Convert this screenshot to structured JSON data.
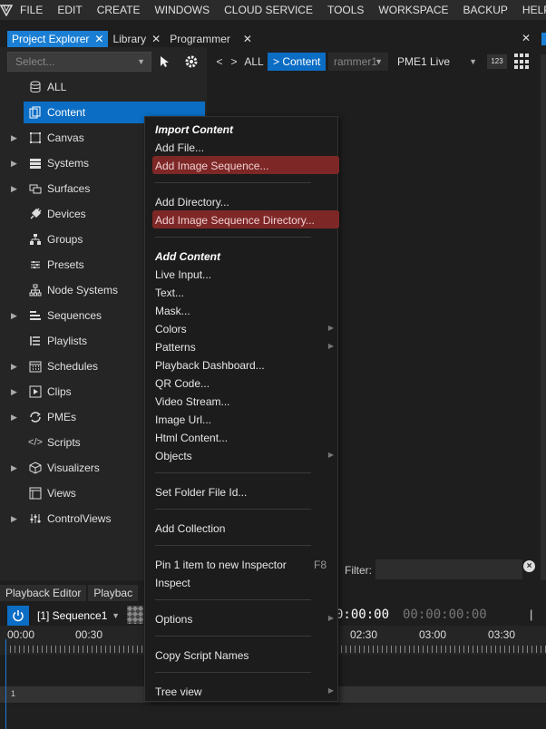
{
  "menubar": {
    "items": [
      "FILE",
      "EDIT",
      "CREATE",
      "WINDOWS",
      "CLOUD SERVICE",
      "TOOLS",
      "WORKSPACE",
      "BACKUP",
      "HELP"
    ]
  },
  "panel_tabs": [
    {
      "label": "Project Explorer",
      "active": true
    },
    {
      "label": "Library",
      "active": false
    },
    {
      "label": "Programmer",
      "active": false
    }
  ],
  "explorer": {
    "select_placeholder": "Select...",
    "tree": [
      {
        "label": "ALL",
        "icon": "database-icon",
        "expandable": false
      },
      {
        "label": "Content",
        "icon": "content-copy-icon",
        "expandable": false,
        "selected": true
      },
      {
        "label": "Canvas",
        "icon": "canvas-icon",
        "expandable": true
      },
      {
        "label": "Systems",
        "icon": "server-icon",
        "expandable": true
      },
      {
        "label": "Surfaces",
        "icon": "surfaces-icon",
        "expandable": true
      },
      {
        "label": "Devices",
        "icon": "plug-icon",
        "expandable": false
      },
      {
        "label": "Groups",
        "icon": "groups-icon",
        "expandable": false
      },
      {
        "label": "Presets",
        "icon": "sliders-icon",
        "expandable": false
      },
      {
        "label": "Node Systems",
        "icon": "node-tree-icon",
        "expandable": false
      },
      {
        "label": "Sequences",
        "icon": "sequences-icon",
        "expandable": true
      },
      {
        "label": "Playlists",
        "icon": "playlist-icon",
        "expandable": false
      },
      {
        "label": "Schedules",
        "icon": "calendar-icon",
        "expandable": true
      },
      {
        "label": "Clips",
        "icon": "clips-icon",
        "expandable": true
      },
      {
        "label": "PMEs",
        "icon": "sync-icon",
        "expandable": true
      },
      {
        "label": "Scripts",
        "icon": "code-icon",
        "expandable": false
      },
      {
        "label": "Visualizers",
        "icon": "cube-icon",
        "expandable": true
      },
      {
        "label": "Views",
        "icon": "views-icon",
        "expandable": false
      },
      {
        "label": "ControlViews",
        "icon": "control-views-icon",
        "expandable": true
      }
    ]
  },
  "content_toolbar": {
    "back": "<",
    "forward": ">",
    "all": "ALL",
    "crumb": "> Content",
    "programmer_select": "rammer1",
    "pme_select": "PME1 Live",
    "badge": "123"
  },
  "filter": {
    "label": "Filter:",
    "value": ""
  },
  "playback": {
    "tabs": [
      "Playback Editor",
      "Playbac"
    ],
    "sequence": "[1] Sequence1",
    "timecode_current": "0:00:00",
    "timecode_total": "00:00:00:00",
    "ruler_labels": [
      "00:00",
      "00:30",
      "02:30",
      "03:00",
      "03:30"
    ],
    "track_number": "1"
  },
  "context_menu": {
    "items": [
      {
        "type": "header",
        "label": "Import Content"
      },
      {
        "type": "item",
        "label": "Add File..."
      },
      {
        "type": "item",
        "label": "Add Image Sequence...",
        "highlight": true
      },
      {
        "type": "separator"
      },
      {
        "type": "item",
        "label": "Add Directory..."
      },
      {
        "type": "item",
        "label": "Add Image Sequence Directory...",
        "highlight": true
      },
      {
        "type": "separator"
      },
      {
        "type": "header",
        "label": "Add Content"
      },
      {
        "type": "item",
        "label": "Live Input..."
      },
      {
        "type": "item",
        "label": "Text..."
      },
      {
        "type": "item",
        "label": "Mask..."
      },
      {
        "type": "item",
        "label": "Colors",
        "submenu": true
      },
      {
        "type": "item",
        "label": "Patterns",
        "submenu": true
      },
      {
        "type": "item",
        "label": "Playback Dashboard..."
      },
      {
        "type": "item",
        "label": "QR Code..."
      },
      {
        "type": "item",
        "label": "Video Stream..."
      },
      {
        "type": "item",
        "label": "Image Url..."
      },
      {
        "type": "item",
        "label": "Html Content..."
      },
      {
        "type": "item",
        "label": "Objects",
        "submenu": true
      },
      {
        "type": "separator"
      },
      {
        "type": "item",
        "label": "Set Folder File Id..."
      },
      {
        "type": "separator"
      },
      {
        "type": "item",
        "label": "Add Collection"
      },
      {
        "type": "separator"
      },
      {
        "type": "item",
        "label": "Pin 1 item to new Inspector",
        "shortcut": "F8"
      },
      {
        "type": "item",
        "label": "Inspect"
      },
      {
        "type": "separator"
      },
      {
        "type": "item",
        "label": "Options",
        "submenu": true
      },
      {
        "type": "separator"
      },
      {
        "type": "item",
        "label": "Copy Script Names"
      },
      {
        "type": "separator"
      },
      {
        "type": "item",
        "label": "Tree view",
        "submenu": true
      }
    ]
  },
  "colors": {
    "accent": "#0b6dc4",
    "highlight": "#7e2727",
    "background": "#1e1e1e"
  }
}
